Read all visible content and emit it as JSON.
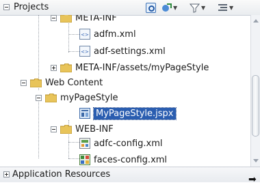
{
  "header": {
    "title": "Projects"
  },
  "tree": {
    "rows": [
      {
        "label": "META-INF"
      },
      {
        "label": "adfm.xml"
      },
      {
        "label": "adf-settings.xml"
      },
      {
        "label": "META-INF/assets/myPageStyle"
      },
      {
        "label": "Web Content"
      },
      {
        "label": "myPageStyle"
      },
      {
        "label": "MyPageStyle.jspx"
      },
      {
        "label": "WEB-INF"
      },
      {
        "label": "adfc-config.xml"
      },
      {
        "label": "faces-config.xml"
      }
    ],
    "selected": "MyPageStyle.jspx"
  },
  "footer": {
    "title": "Application Resources"
  },
  "colors": {
    "selection": "#2a5db0",
    "folder": "#e8c45a"
  }
}
